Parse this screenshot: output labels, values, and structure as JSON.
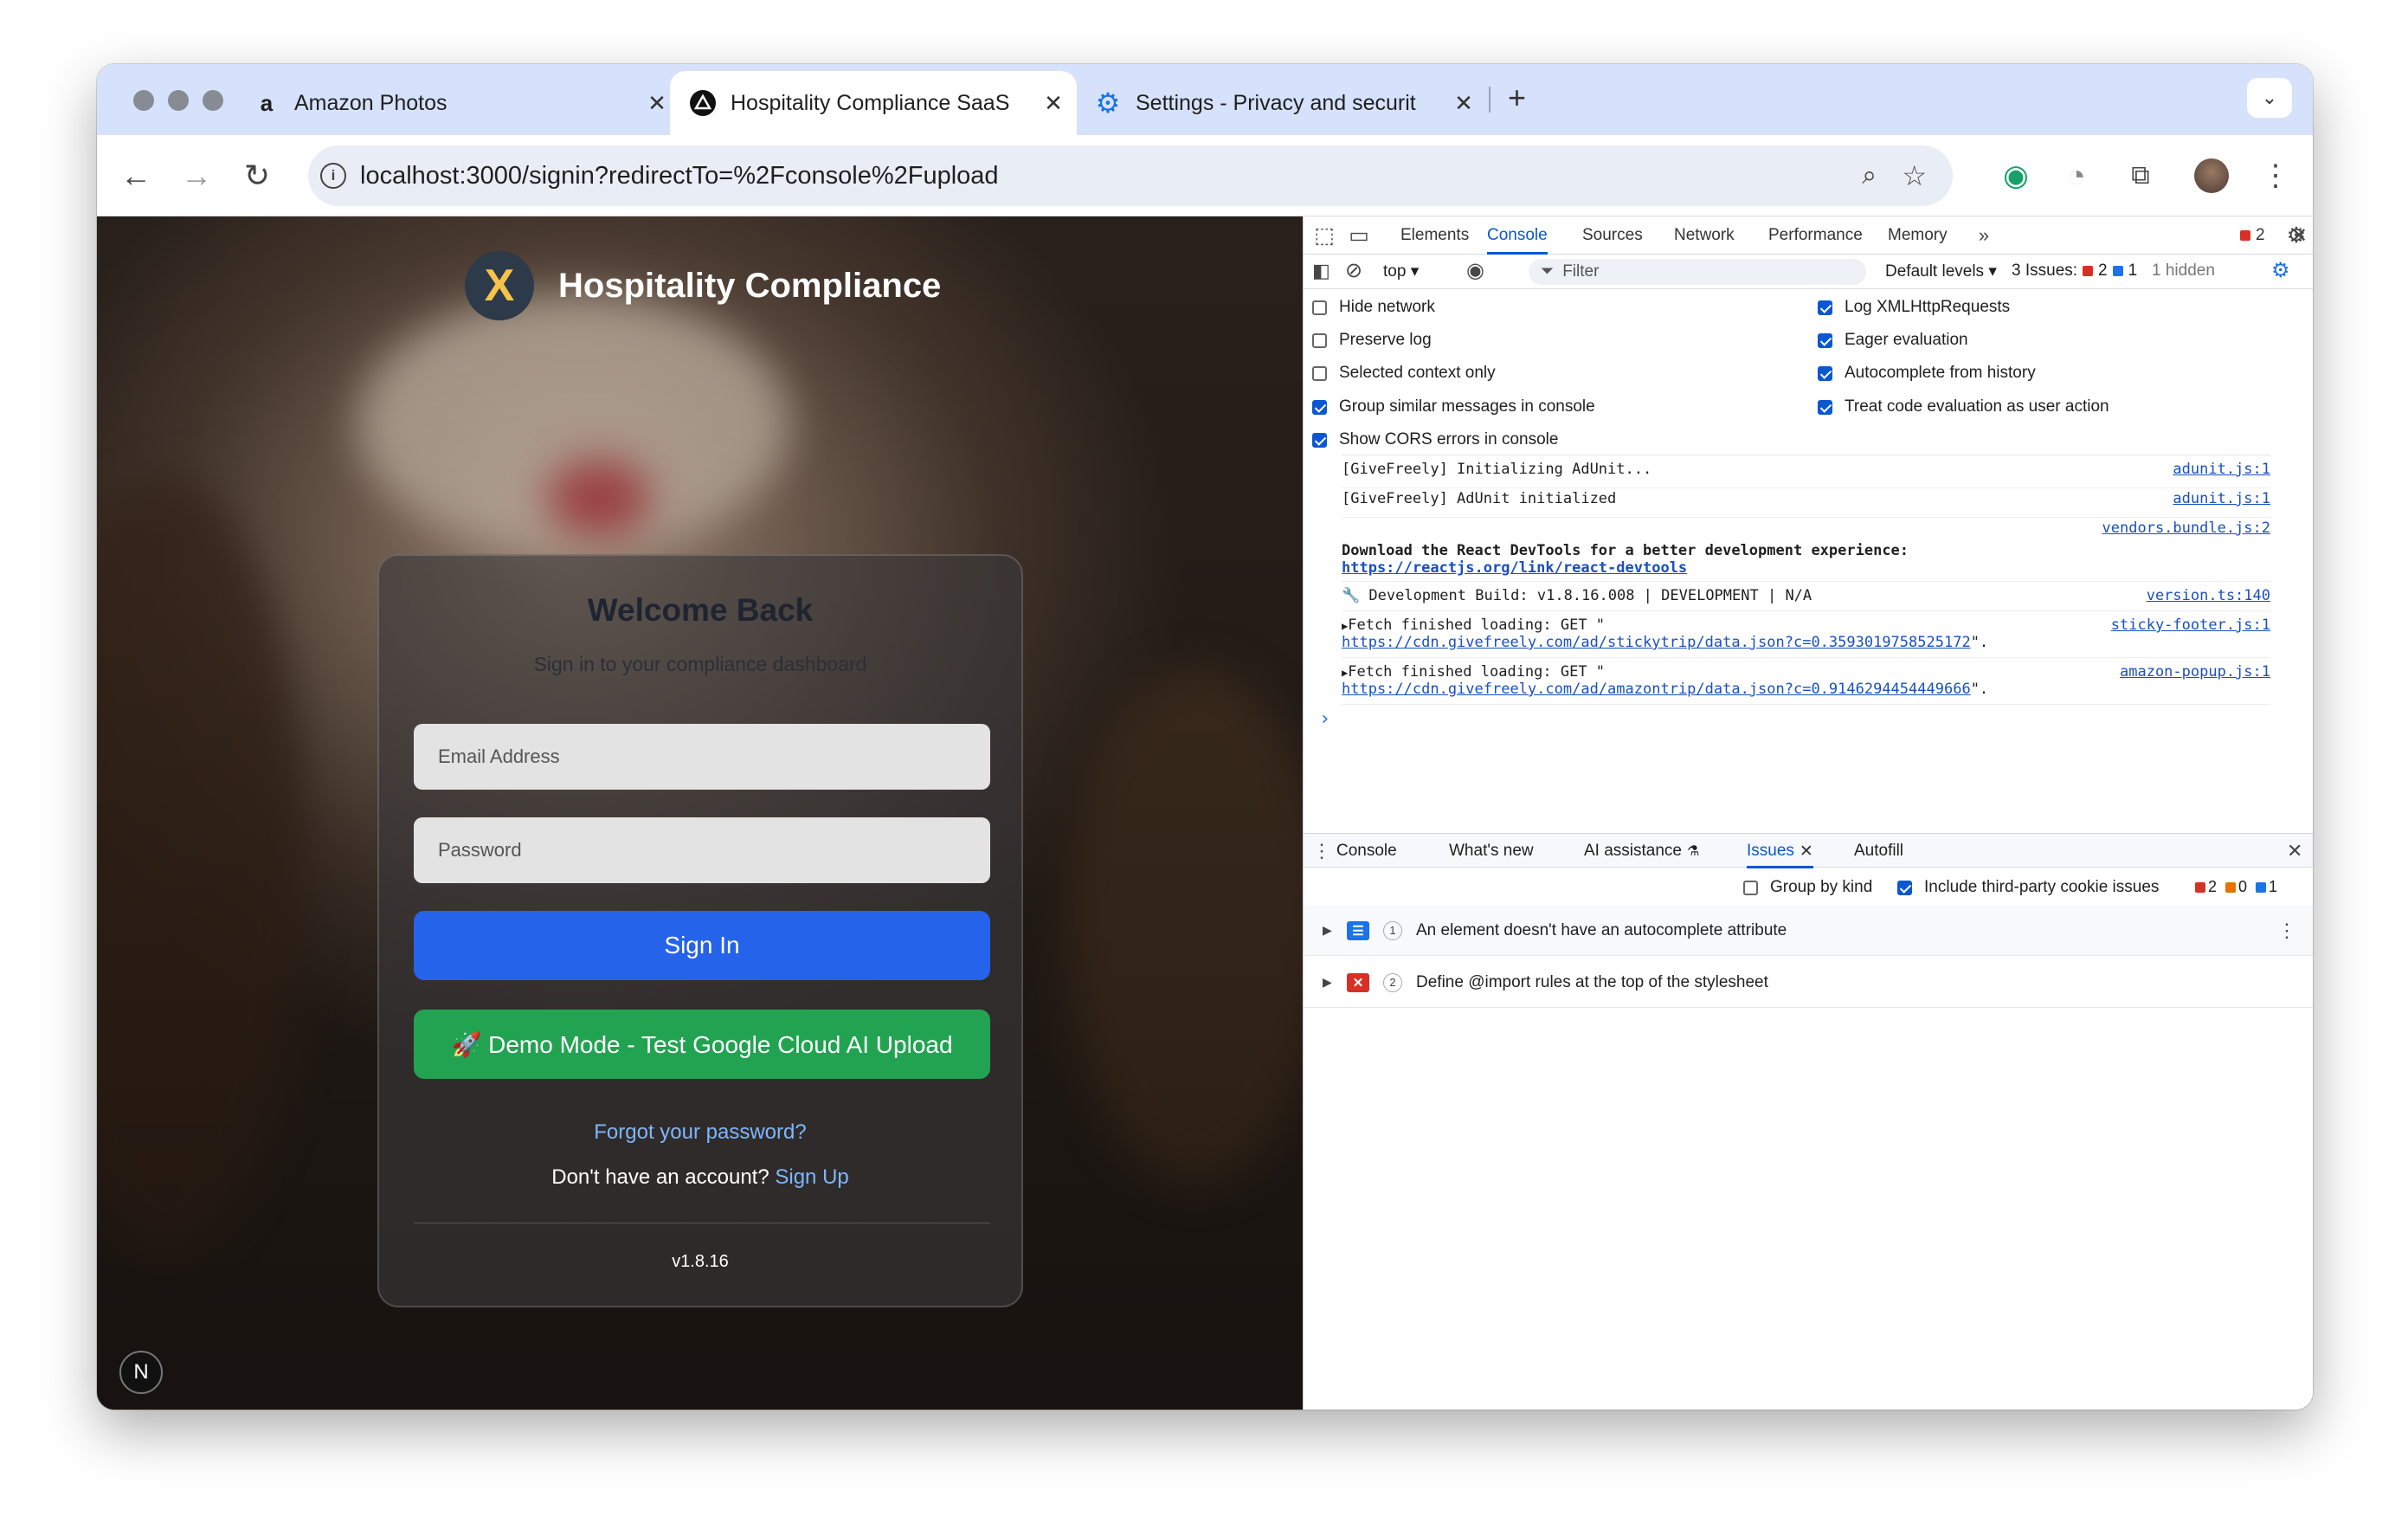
{
  "tabs": [
    {
      "title": "Amazon Photos",
      "icon": "amazon-icon"
    },
    {
      "title": "Hospitality Compliance SaaS",
      "icon": "nextjs-icon"
    },
    {
      "title": "Settings - Privacy and securit",
      "icon": "gear-icon"
    }
  ],
  "address": {
    "url": "localhost:3000/signin?redirectTo=%2Fconsole%2Fupload"
  },
  "page": {
    "brand": "Hospitality Compliance",
    "title": "Welcome Back",
    "subtitle": "Sign in to your compliance dashboard",
    "email_placeholder": "Email Address",
    "password_placeholder": "Password",
    "signin_label": "Sign In",
    "demo_label": "🚀 Demo Mode - Test Google Cloud AI Upload",
    "forgot_label": "Forgot your password?",
    "no_account_label": "Don't have an account?",
    "signup_label": "Sign Up",
    "version": "v1.8.16",
    "next_badge": "N"
  },
  "devtools": {
    "tabs": [
      "Elements",
      "Console",
      "Sources",
      "Network",
      "Performance",
      "Memory"
    ],
    "error_badge": "2",
    "context": "top",
    "filter_placeholder": "Filter",
    "levels": "Default levels",
    "issues_label": "3 Issues:",
    "issues_errors": "2",
    "issues_info": "1",
    "hidden": "1 hidden",
    "settings_left": [
      {
        "label": "Hide network",
        "checked": false
      },
      {
        "label": "Preserve log",
        "checked": false
      },
      {
        "label": "Selected context only",
        "checked": false
      },
      {
        "label": "Group similar messages in console",
        "checked": true
      },
      {
        "label": "Show CORS errors in console",
        "checked": true
      }
    ],
    "settings_right": [
      {
        "label": "Log XMLHttpRequests",
        "checked": true
      },
      {
        "label": "Eager evaluation",
        "checked": true
      },
      {
        "label": "Autocomplete from history",
        "checked": true
      },
      {
        "label": "Treat code evaluation as user action",
        "checked": true
      }
    ],
    "log": [
      {
        "text": "[GiveFreely] Initializing AdUnit...",
        "source": "adunit.js:1"
      },
      {
        "text": "[GiveFreely] AdUnit initialized",
        "source": "adunit.js:1"
      },
      {
        "text": "Download the React DevTools for a better development experience:",
        "link": "https://reactjs.org/link/react-devtools",
        "source": "vendors.bundle.js:2"
      },
      {
        "text": "🔧 Development Build: v1.8.16.008 | DEVELOPMENT | N/A",
        "source": "version.ts:140"
      },
      {
        "text": "Fetch finished loading: GET \"",
        "link": "https://cdn.givefreely.com/ad/stickytrip/data.json?c=0.3593019758525172",
        "suffix": "\".",
        "source": "sticky-footer.js:1"
      },
      {
        "text": "Fetch finished loading: GET \"",
        "link": "https://cdn.givefreely.com/ad/amazontrip/data.json?c=0.9146294454449666",
        "suffix": "\".",
        "source": "amazon-popup.js:1"
      }
    ],
    "prompt": "›",
    "drawer_tabs": [
      "Console",
      "What's new",
      "AI assistance",
      "Issues",
      "Autofill"
    ],
    "group_by_kind": "Group by kind",
    "third_party": "Include third-party cookie issues",
    "counts": {
      "errors": "2",
      "warnings": "0",
      "info": "1"
    },
    "issues": [
      {
        "count": "1",
        "text": "An element doesn't have an autocomplete attribute",
        "kind": "info"
      },
      {
        "count": "2",
        "text": "Define @import rules at the top of the stylesheet",
        "kind": "error"
      }
    ]
  }
}
